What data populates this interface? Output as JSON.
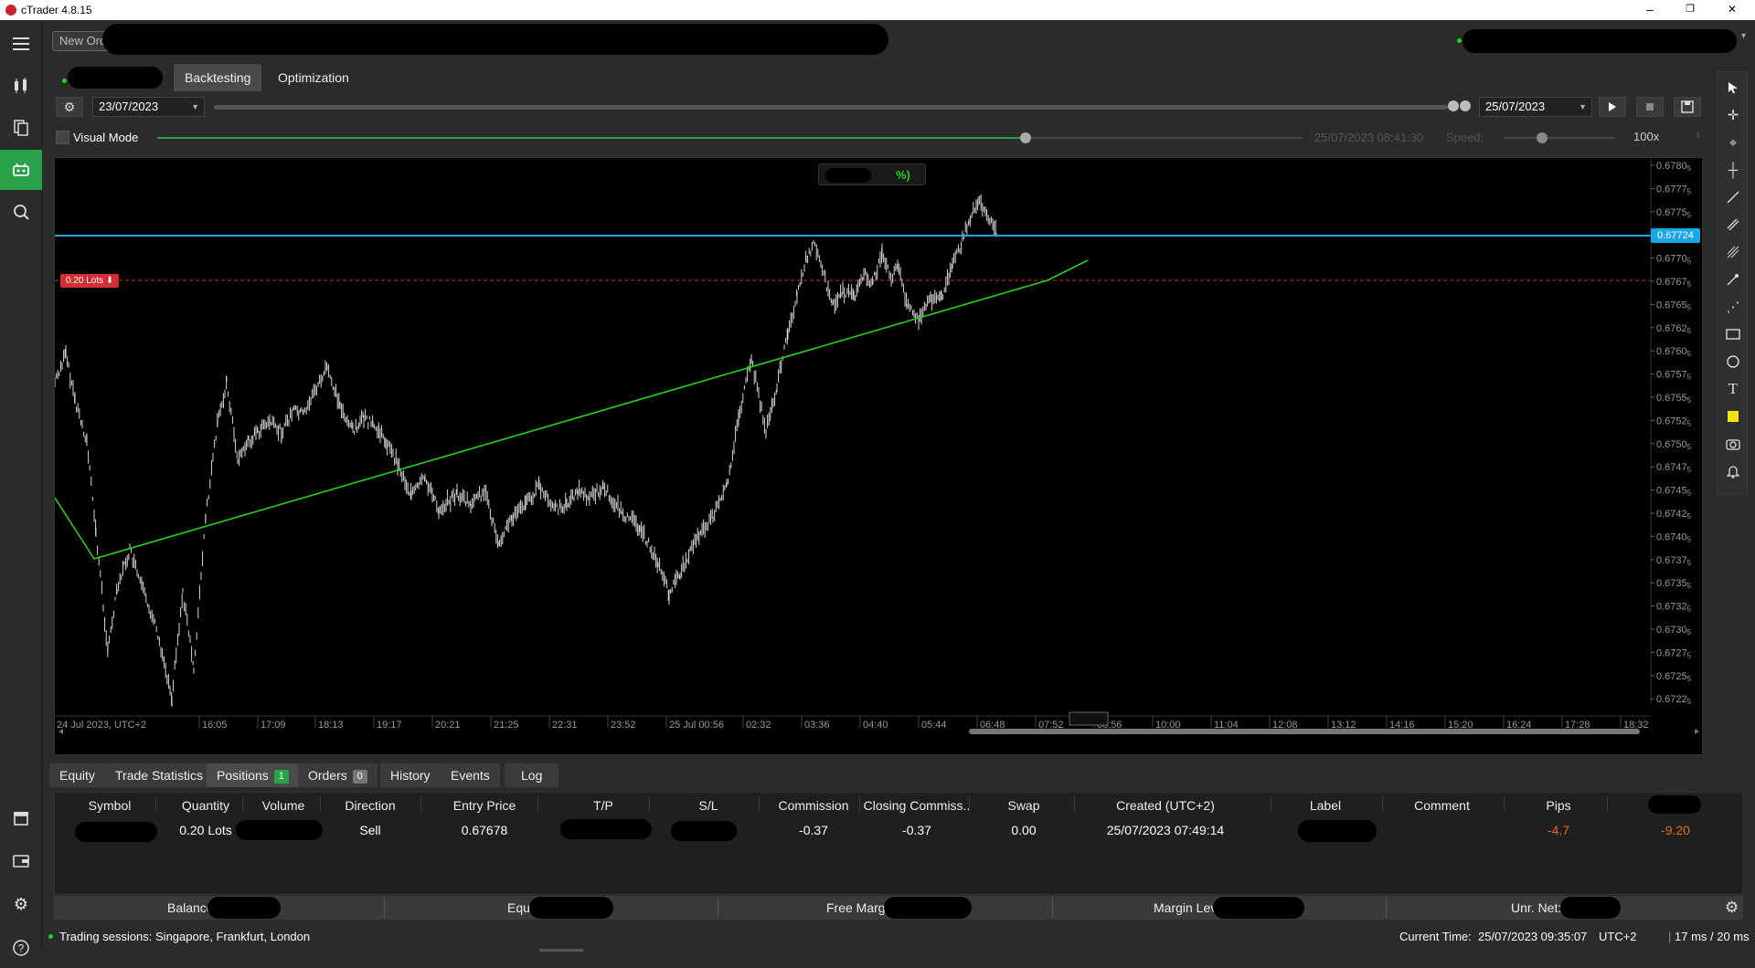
{
  "window": {
    "title": "cTrader 4.8.15",
    "minimize": "–",
    "restore": "❐",
    "close": "✕"
  },
  "top": {
    "new_order_label": "New Order"
  },
  "tabs": [
    {
      "label": "Backtesting"
    },
    {
      "label": "Optimization"
    }
  ],
  "backtest": {
    "start_date": "23/07/2023",
    "end_date": "25/07/2023",
    "visual_mode_label": "Visual Mode",
    "visual_mode_checked": false,
    "current_timestamp": "25/07/2023 08:41:30",
    "speed_label": "Speed:",
    "speed_value": "100x"
  },
  "chart": {
    "pnl_badge_fragment": "%)",
    "position_label": "0.20 Lots ⬇",
    "current_price": "0.67724",
    "price_ticks": [
      "0.6780",
      "0.6777",
      "0.6775",
      "0.6772",
      "0.6770",
      "0.6767",
      "0.6765",
      "0.6762",
      "0.6760",
      "0.6757",
      "0.6755",
      "0.6752",
      "0.6750",
      "0.6747",
      "0.6745",
      "0.6742",
      "0.6740",
      "0.6737",
      "0.6735",
      "0.6732",
      "0.6730",
      "0.6727",
      "0.6725",
      "0.6722"
    ],
    "price_tick_suffix": "5",
    "time_ticks": [
      "24 Jul 2023, UTC+2",
      "16:05",
      "17:09",
      "18:13",
      "19:17",
      "20:21",
      "21:25",
      "22:31",
      "23:52",
      "25 Jul 00:56",
      "02:32",
      "03:36",
      "04:40",
      "05:44",
      "06:48",
      "07:52",
      "08:56",
      "10:00",
      "11:04",
      "12:08",
      "13:12",
      "14:16",
      "15:20",
      "16:24",
      "17:28",
      "18:32"
    ],
    "colors": {
      "price_line": "#18a8e8",
      "trendline": "#1fd41f",
      "sell_line": "#d23030",
      "candles": "#d8d8d8"
    }
  },
  "bottom_tabs": [
    {
      "label": "Equity"
    },
    {
      "label": "Trade Statistics"
    },
    {
      "label": "Positions",
      "badge": "1"
    },
    {
      "label": "Orders",
      "badge": "0"
    },
    {
      "label": "History"
    },
    {
      "label": "Events"
    },
    {
      "label": "Log"
    }
  ],
  "positions": {
    "headers": [
      "Symbol",
      "Quantity",
      "Volume",
      "Direction",
      "Entry Price",
      "T/P",
      "S/L",
      "Commission",
      "Closing Commiss..",
      "Swap",
      "Created (UTC+2)",
      "Label",
      "Comment",
      "Pips"
    ],
    "row": {
      "quantity": "0.20 Lots",
      "direction": "Sell",
      "entry_price": "0.67678",
      "commission": "-0.37",
      "closing_commission": "-0.37",
      "swap": "0.00",
      "created": "25/07/2023 07:49:14",
      "pips": "-4.7",
      "net": "-9.20"
    }
  },
  "summary": {
    "balance": "Balance",
    "equity": "Equ",
    "free_margin": "Free Marg",
    "margin_level": "Margin Lev",
    "unr_net": "Unr. Net:"
  },
  "status": {
    "sessions": "Trading sessions: Singapore, Frankfurt, London",
    "current_time_label": "Current Time:",
    "current_time": "25/07/2023 09:35:07",
    "timezone": "UTC+2",
    "latency": "17 ms / 20 ms"
  }
}
